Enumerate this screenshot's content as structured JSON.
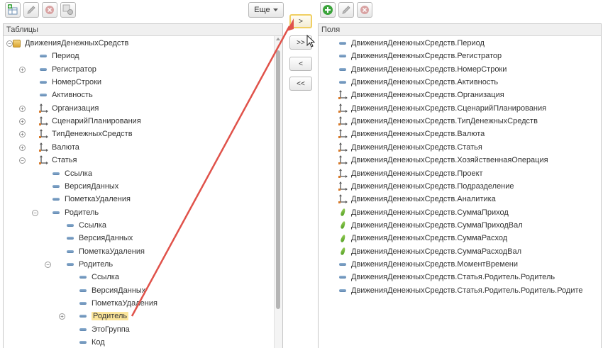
{
  "left_toolbar": {
    "icons": [
      "add-table-icon",
      "edit-pencil-icon",
      "delete-icon",
      "options-icon"
    ],
    "more_label": "Еще",
    "more_icon": "dropdown-triangle-icon"
  },
  "right_toolbar": {
    "icons": [
      "add-circle-icon",
      "edit-pencil-icon",
      "delete-icon"
    ]
  },
  "left_panel": {
    "header": "Таблицы",
    "items": [
      {
        "label": "ДвиженияДенежныхСредств",
        "icon": "register-icon",
        "expander": "minus",
        "level": 0
      },
      {
        "label": "Период",
        "icon": "field-icon",
        "expander": "",
        "level": 1
      },
      {
        "label": "Регистратор",
        "icon": "field-icon",
        "expander": "plus",
        "level": 1
      },
      {
        "label": "НомерСтроки",
        "icon": "field-icon",
        "expander": "",
        "level": 1
      },
      {
        "label": "Активность",
        "icon": "field-icon",
        "expander": "",
        "level": 1
      },
      {
        "label": "Организация",
        "icon": "dimension-icon",
        "expander": "plus",
        "level": 1
      },
      {
        "label": "СценарийПланирования",
        "icon": "dimension-icon",
        "expander": "plus",
        "level": 1
      },
      {
        "label": "ТипДенежныхСредств",
        "icon": "dimension-icon",
        "expander": "plus",
        "level": 1
      },
      {
        "label": "Валюта",
        "icon": "dimension-icon",
        "expander": "plus",
        "level": 1
      },
      {
        "label": "Статья",
        "icon": "dimension-icon",
        "expander": "minus",
        "level": 1
      },
      {
        "label": "Ссылка",
        "icon": "field-icon",
        "expander": "",
        "level": 2
      },
      {
        "label": "ВерсияДанных",
        "icon": "field-icon",
        "expander": "",
        "level": 2
      },
      {
        "label": "ПометкаУдаления",
        "icon": "field-icon",
        "expander": "",
        "level": 2
      },
      {
        "label": "Родитель",
        "icon": "field-icon",
        "expander": "minus",
        "level": 2
      },
      {
        "label": "Ссылка",
        "icon": "field-icon",
        "expander": "",
        "level": 3
      },
      {
        "label": "ВерсияДанных",
        "icon": "field-icon",
        "expander": "",
        "level": 3
      },
      {
        "label": "ПометкаУдаления",
        "icon": "field-icon",
        "expander": "",
        "level": 3
      },
      {
        "label": "Родитель",
        "icon": "field-icon",
        "expander": "minus",
        "level": 3
      },
      {
        "label": "Ссылка",
        "icon": "field-icon",
        "expander": "",
        "level": 4
      },
      {
        "label": "ВерсияДанных",
        "icon": "field-icon",
        "expander": "",
        "level": 4
      },
      {
        "label": "ПометкаУдаления",
        "icon": "field-icon",
        "expander": "",
        "level": 4
      },
      {
        "label": "Родитель",
        "icon": "field-icon",
        "expander": "plus",
        "level": 4,
        "selected": true
      },
      {
        "label": "ЭтоГруппа",
        "icon": "field-icon",
        "expander": "",
        "level": 4
      },
      {
        "label": "Код",
        "icon": "field-icon",
        "expander": "",
        "level": 4
      }
    ]
  },
  "middle_buttons": [
    {
      "label": ">",
      "focused": true
    },
    {
      "label": ">>",
      "focused": false
    },
    {
      "label": "<",
      "focused": false
    },
    {
      "label": "<<",
      "focused": false
    }
  ],
  "right_panel": {
    "header": "Поля",
    "items": [
      {
        "label": "ДвиженияДенежныхСредств.Период",
        "icon": "field-icon"
      },
      {
        "label": "ДвиженияДенежныхСредств.Регистратор",
        "icon": "field-icon"
      },
      {
        "label": "ДвиженияДенежныхСредств.НомерСтроки",
        "icon": "field-icon"
      },
      {
        "label": "ДвиженияДенежныхСредств.Активность",
        "icon": "field-icon"
      },
      {
        "label": "ДвиженияДенежныхСредств.Организация",
        "icon": "dimension-icon"
      },
      {
        "label": "ДвиженияДенежныхСредств.СценарийПланирования",
        "icon": "dimension-icon"
      },
      {
        "label": "ДвиженияДенежныхСредств.ТипДенежныхСредств",
        "icon": "dimension-icon"
      },
      {
        "label": "ДвиженияДенежныхСредств.Валюта",
        "icon": "dimension-icon"
      },
      {
        "label": "ДвиженияДенежныхСредств.Статья",
        "icon": "dimension-icon"
      },
      {
        "label": "ДвиженияДенежныхСредств.ХозяйственнаяОперация",
        "icon": "dimension-icon"
      },
      {
        "label": "ДвиженияДенежныхСредств.Проект",
        "icon": "dimension-icon"
      },
      {
        "label": "ДвиженияДенежныхСредств.Подразделение",
        "icon": "dimension-icon"
      },
      {
        "label": "ДвиженияДенежныхСредств.Аналитика",
        "icon": "dimension-icon"
      },
      {
        "label": "ДвиженияДенежныхСредств.СуммаПриход",
        "icon": "resource-icon"
      },
      {
        "label": "ДвиженияДенежныхСредств.СуммаПриходВал",
        "icon": "resource-icon"
      },
      {
        "label": "ДвиженияДенежныхСредств.СуммаРасход",
        "icon": "resource-icon"
      },
      {
        "label": "ДвиженияДенежныхСредств.СуммаРасходВал",
        "icon": "resource-icon"
      },
      {
        "label": "ДвиженияДенежныхСредств.МоментВремени",
        "icon": "field-icon"
      },
      {
        "label": "ДвиженияДенежныхСредств.Статья.Родитель.Родитель",
        "icon": "field-icon"
      },
      {
        "label": "ДвиженияДенежныхСредств.Статья.Родитель.Родитель.Родите",
        "icon": "field-icon"
      }
    ]
  },
  "colors": {
    "selection": "#fbe59a",
    "annotation_arrow": "#e0524a",
    "focus_border": "#f0cf62"
  }
}
